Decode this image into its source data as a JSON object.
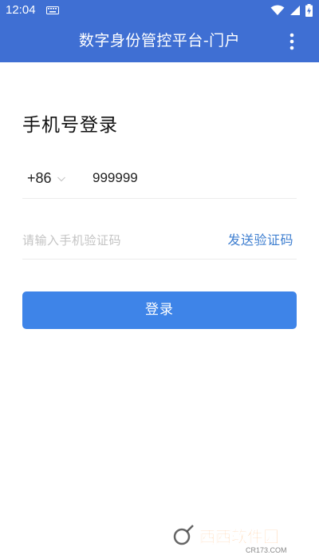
{
  "status_bar": {
    "time": "12:04",
    "icons": [
      "keyboard-icon",
      "wifi-icon",
      "signal-icon",
      "battery-charging-icon"
    ]
  },
  "app_bar": {
    "title": "数字身份管控平台-门户",
    "menu_icon": "more-vertical-icon"
  },
  "login": {
    "heading": "手机号登录",
    "country_code": "+86",
    "phone_value": "999999",
    "code_placeholder": "请输入手机验证码",
    "send_code_label": "发送验证码",
    "submit_label": "登录"
  },
  "watermark": {
    "text": "西西软件园",
    "subtext": "CR173.COM"
  },
  "colors": {
    "app_bar": "#3f6fd3",
    "button": "#3e84e8",
    "link": "#3f7fd0",
    "placeholder": "#c4c4c4"
  }
}
